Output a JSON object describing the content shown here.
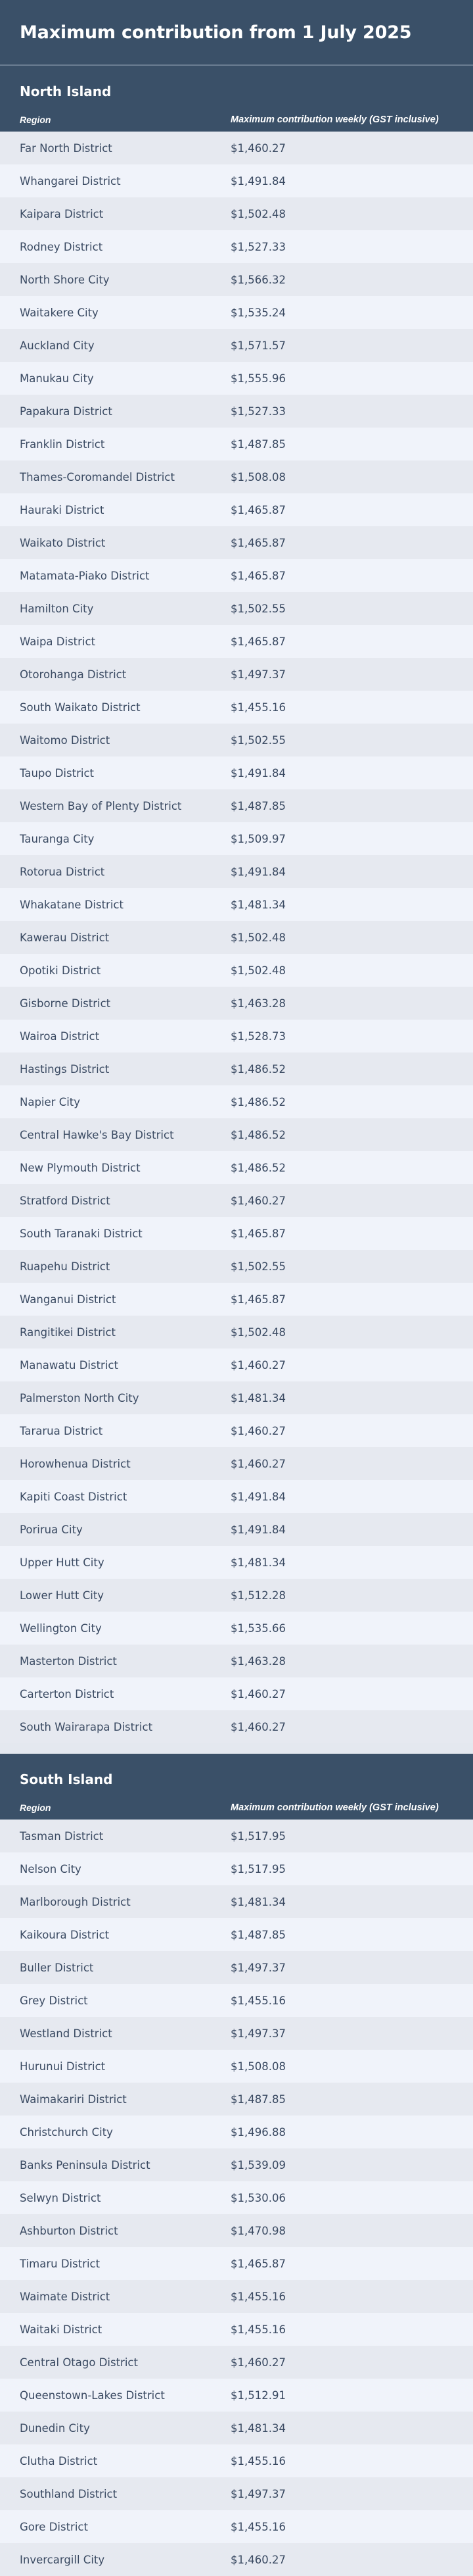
{
  "title": "Maximum contribution from 1 July 2025",
  "sections": [
    {
      "name": "North Island",
      "col_region": "Region",
      "col_value": "Maximum contribution weekly (GST inclusive)",
      "rows": [
        [
          "Far North District",
          "$1,460.27"
        ],
        [
          "Whangarei District",
          "$1,491.84"
        ],
        [
          "Kaipara District",
          "$1,502.48"
        ],
        [
          "Rodney District",
          "$1,527.33"
        ],
        [
          "North Shore City",
          "$1,566.32"
        ],
        [
          "Waitakere City",
          "$1,535.24"
        ],
        [
          "Auckland City",
          "$1,571.57"
        ],
        [
          "Manukau City",
          "$1,555.96"
        ],
        [
          "Papakura District",
          "$1,527.33"
        ],
        [
          "Franklin District",
          "$1,487.85"
        ],
        [
          "Thames-Coromandel District",
          "$1,508.08"
        ],
        [
          "Hauraki District",
          "$1,465.87"
        ],
        [
          "Waikato District",
          "$1,465.87"
        ],
        [
          "Matamata-Piako District",
          "$1,465.87"
        ],
        [
          "Hamilton City",
          "$1,502.55"
        ],
        [
          "Waipa District",
          "$1,465.87"
        ],
        [
          "Otorohanga District",
          "$1,497.37"
        ],
        [
          "South Waikato District",
          "$1,455.16"
        ],
        [
          "Waitomo District",
          "$1,502.55"
        ],
        [
          "Taupo District",
          "$1,491.84"
        ],
        [
          "Western Bay of Plenty District",
          "$1,487.85"
        ],
        [
          "Tauranga City",
          "$1,509.97"
        ],
        [
          "Rotorua District",
          "$1,491.84"
        ],
        [
          "Whakatane District",
          "$1,481.34"
        ],
        [
          "Kawerau District",
          "$1,502.48"
        ],
        [
          "Opotiki District",
          "$1,502.48"
        ],
        [
          "Gisborne District",
          "$1,463.28"
        ],
        [
          "Wairoa District",
          "$1,528.73"
        ],
        [
          "Hastings District",
          "$1,486.52"
        ],
        [
          "Napier City",
          "$1,486.52"
        ],
        [
          "Central Hawke's Bay District",
          "$1,486.52"
        ],
        [
          "New Plymouth District",
          "$1,486.52"
        ],
        [
          "Stratford District",
          "$1,460.27"
        ],
        [
          "South Taranaki District",
          "$1,465.87"
        ],
        [
          "Ruapehu District",
          "$1,502.55"
        ],
        [
          "Wanganui District",
          "$1,465.87"
        ],
        [
          "Rangitikei District",
          "$1,502.48"
        ],
        [
          "Manawatu District",
          "$1,460.27"
        ],
        [
          "Palmerston North City",
          "$1,481.34"
        ],
        [
          "Tararua District",
          "$1,460.27"
        ],
        [
          "Horowhenua District",
          "$1,460.27"
        ],
        [
          "Kapiti Coast District",
          "$1,491.84"
        ],
        [
          "Porirua City",
          "$1,491.84"
        ],
        [
          "Upper Hutt City",
          "$1,481.34"
        ],
        [
          "Lower Hutt City",
          "$1,512.28"
        ],
        [
          "Wellington City",
          "$1,535.66"
        ],
        [
          "Masterton District",
          "$1,463.28"
        ],
        [
          "Carterton District",
          "$1,460.27"
        ],
        [
          "South Wairarapa District",
          "$1,460.27"
        ]
      ]
    },
    {
      "name": "South Island",
      "col_region": "Region",
      "col_value": "Maximum contribution weekly (GST inclusive)",
      "rows": [
        [
          "Tasman District",
          "$1,517.95"
        ],
        [
          "Nelson City",
          "$1,517.95"
        ],
        [
          "Marlborough District",
          "$1,481.34"
        ],
        [
          "Kaikoura District",
          "$1,487.85"
        ],
        [
          "Buller District",
          "$1,497.37"
        ],
        [
          "Grey District",
          "$1,455.16"
        ],
        [
          "Westland District",
          "$1,497.37"
        ],
        [
          "Hurunui District",
          "$1,508.08"
        ],
        [
          "Waimakariri District",
          "$1,487.85"
        ],
        [
          "Christchurch City",
          "$1,496.88"
        ],
        [
          "Banks Peninsula District",
          "$1,539.09"
        ],
        [
          "Selwyn District",
          "$1,530.06"
        ],
        [
          "Ashburton District",
          "$1,470.98"
        ],
        [
          "Timaru District",
          "$1,465.87"
        ],
        [
          "Waimate District",
          "$1,455.16"
        ],
        [
          "Waitaki District",
          "$1,455.16"
        ],
        [
          "Central Otago District",
          "$1,460.27"
        ],
        [
          "Queenstown-Lakes District",
          "$1,512.91"
        ],
        [
          "Dunedin City",
          "$1,481.34"
        ],
        [
          "Clutha District",
          "$1,455.16"
        ],
        [
          "Southland District",
          "$1,497.37"
        ],
        [
          "Gore District",
          "$1,455.16"
        ],
        [
          "Invercargill City",
          "$1,460.27"
        ]
      ]
    }
  ]
}
